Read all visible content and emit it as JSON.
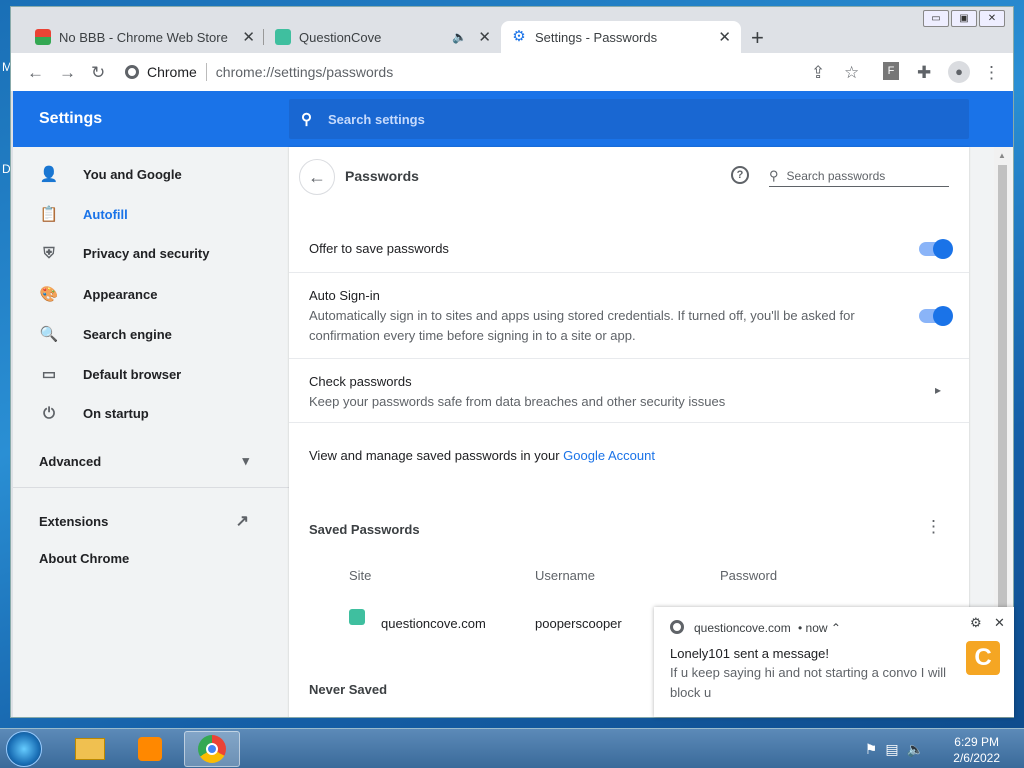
{
  "desktop": {
    "left_letters": [
      "M",
      "D"
    ]
  },
  "tabs": [
    {
      "title": "No BBB - Chrome Web Store",
      "close": "✕"
    },
    {
      "title": "QuestionCove",
      "audio": "🔈",
      "close": "✕"
    },
    {
      "title": "Settings - Passwords",
      "close": "✕"
    }
  ],
  "new_tab": "+",
  "window_controls": {
    "min": "▭",
    "max": "▣",
    "close": "✕"
  },
  "toolbar": {
    "back": "←",
    "forward": "→",
    "reload": "↻",
    "site_label": "Chrome",
    "url": "chrome://settings/passwords",
    "share": "⇪",
    "star": "☆",
    "ext_f": "F",
    "puzzle": "✚",
    "profile": "●",
    "menu": "⋮"
  },
  "settings": {
    "title": "Settings",
    "search_placeholder": "Search settings"
  },
  "sidebar": {
    "items": [
      {
        "label": "You and Google",
        "icon": "person-icon",
        "glyph": "👤"
      },
      {
        "label": "Autofill",
        "icon": "clipboard-icon",
        "glyph": "📋",
        "active": true
      },
      {
        "label": "Privacy and security",
        "icon": "shield-icon",
        "glyph": "⛨"
      },
      {
        "label": "Appearance",
        "icon": "palette-icon",
        "glyph": "🎨"
      },
      {
        "label": "Search engine",
        "icon": "search-icon",
        "glyph": "🔍"
      },
      {
        "label": "Default browser",
        "icon": "browser-icon",
        "glyph": "▭"
      },
      {
        "label": "On startup",
        "icon": "power-icon",
        "glyph": "⏻"
      }
    ],
    "advanced": "Advanced",
    "advanced_caret": "▾",
    "extensions": "Extensions",
    "extensions_icon": "↗",
    "about": "About Chrome"
  },
  "passwords": {
    "back_arrow": "←",
    "title": "Passwords",
    "help": "?",
    "search_placeholder": "Search passwords",
    "offer_to_save": "Offer to save passwords",
    "offer_to_save_enabled": true,
    "auto_signin_title": "Auto Sign-in",
    "auto_signin_desc_1": "Automatically sign in to sites and apps using stored credentials. If turned off, you'll be asked for",
    "auto_signin_desc_2": "confirmation every time before signing in to a site or app.",
    "auto_signin_enabled": true,
    "check_title": "Check passwords",
    "check_desc": "Keep your passwords safe from data breaches and other security issues",
    "check_chevron": "▸",
    "manage_text": "View and manage saved passwords in your ",
    "manage_link": "Google Account",
    "saved_title": "Saved Passwords",
    "saved_menu": "⋮",
    "columns": [
      "Site",
      "Username",
      "Password"
    ],
    "rows": [
      {
        "site": "questioncove.com",
        "username": "pooperscooper"
      }
    ],
    "never_saved": "Never Saved"
  },
  "notification": {
    "source": "questioncove.com",
    "time": "• now ⌃",
    "title": "Lonely101 sent a message!",
    "body_1": "If u keep saying hi and not starting a convo I will",
    "body_2": "block u",
    "gear": "⚙",
    "close": "✕"
  },
  "taskbar": {
    "time": "6:29 PM",
    "date": "2/6/2022",
    "tray_icons": [
      "⚑",
      "▤",
      "🔈"
    ]
  },
  "colors": {
    "accent": "#1a73e8",
    "header": "#1a73e8",
    "link": "#1a73e8"
  }
}
